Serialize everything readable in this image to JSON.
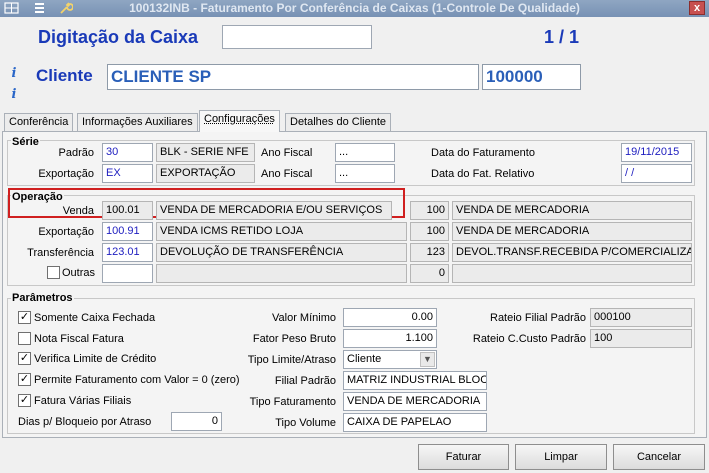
{
  "window": {
    "title": "100132INB - Faturamento Por Conferência de Caixas (1-Controle De Qualidade)",
    "close": "x"
  },
  "header": {
    "title": "Digitação da Caixa",
    "caixa_value": "",
    "page": "1 / 1"
  },
  "cliente": {
    "label": "Cliente",
    "name": "CLIENTE SP",
    "code": "100000"
  },
  "tabs": [
    {
      "label": "Conferência"
    },
    {
      "label": "Informações Auxiliares"
    },
    {
      "label": "Configurações",
      "active": true
    },
    {
      "label": "Detalhes do Cliente"
    }
  ],
  "serie": {
    "title": "Série",
    "padrao": {
      "label": "Padrão",
      "code": "30",
      "desc": "BLK - SERIE NFE",
      "ano_label": "Ano Fiscal",
      "ano": "...",
      "data_label": "Data  do Faturamento",
      "data": "19/11/2015"
    },
    "exportacao": {
      "label": "Exportação",
      "code": "EX",
      "desc": "EXPORTAÇÃO",
      "ano_label": "Ano Fiscal",
      "ano": "...",
      "data_label": "Data  do Fat. Relativo",
      "data": " / /"
    }
  },
  "operacao": {
    "title": "Operação",
    "venda": {
      "label": "Venda",
      "code": "100.01",
      "desc": "VENDA DE MERCADORIA E/OU SERVIÇOS",
      "num": "100",
      "num_desc": "VENDA DE MERCADORIA"
    },
    "exportacao": {
      "label": "Exportação",
      "code": "100.91",
      "desc": "VENDA ICMS RETIDO LOJA",
      "num": "100",
      "num_desc": "VENDA DE MERCADORIA"
    },
    "transferencia": {
      "label": "Transferência",
      "code": "123.01",
      "desc": "DEVOLUÇÃO DE TRANSFERÊNCIA",
      "num": "123",
      "num_desc": "DEVOL.TRANSF.RECEBIDA P/COMERCIALIZAÇÃ"
    },
    "outras": {
      "label": "Outras",
      "code": "",
      "desc": "",
      "num": "0",
      "num_desc": ""
    }
  },
  "parametros": {
    "title": "Parâmetros",
    "checks": [
      {
        "label": "Somente Caixa Fechada",
        "checked": true
      },
      {
        "label": "Nota Fiscal Fatura",
        "checked": false
      },
      {
        "label": "Verifica Limite de Crédito",
        "checked": true
      },
      {
        "label": "Permite Faturamento com Valor = 0 (zero)",
        "checked": true
      },
      {
        "label": "Fatura Várias Filiais",
        "checked": true
      }
    ],
    "dias_label": "Dias p/ Bloqueio por Atraso",
    "dias": "0",
    "valor_minimo": {
      "label": "Valor Mínimo",
      "value": "0.00"
    },
    "fator_peso": {
      "label": "Fator Peso Bruto",
      "value": "1.100"
    },
    "tipo_limite": {
      "label": "Tipo Limite/Atraso",
      "value": "Cliente"
    },
    "filial_padrao": {
      "label": "Filial Padrão",
      "value": "MATRIZ INDUSTRIAL BLOCO"
    },
    "tipo_faturamento": {
      "label": "Tipo Faturamento",
      "value": "VENDA DE MERCADORIA"
    },
    "tipo_volume": {
      "label": "Tipo Volume",
      "value": "CAIXA DE PAPELAO"
    },
    "rateio_filial": {
      "label": "Rateio Filial Padrão",
      "value": "000100"
    },
    "rateio_custo": {
      "label": "Rateio C.Custo Padrão",
      "value": "100"
    }
  },
  "buttons": {
    "faturar": "Faturar",
    "limpar": "Limpar",
    "cancelar": "Cancelar"
  },
  "colors": {
    "accent": "#1a3ab8",
    "highlight": "#d02020"
  }
}
